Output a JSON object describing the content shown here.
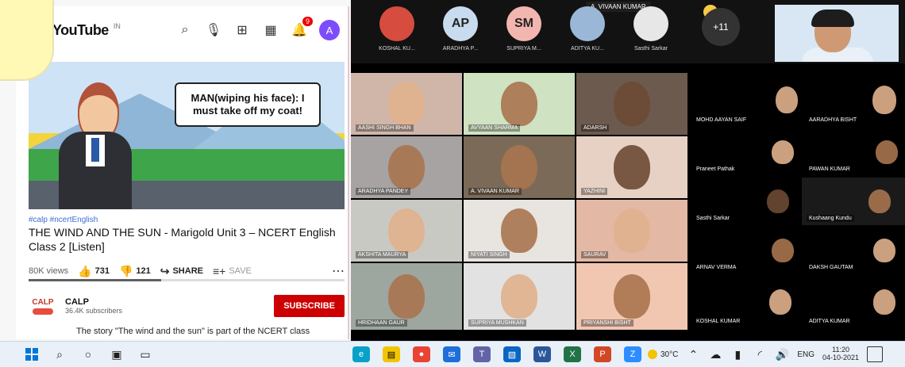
{
  "youtube": {
    "brand": "YouTube",
    "brand_sup": "IN",
    "notifications_badge": "9",
    "avatar_letter": "A",
    "video_speech": "MAN(wiping his face): I must take off my coat!",
    "hashtags": "#calp #ncertEnglish",
    "title": "THE WIND AND THE SUN - Marigold Unit 3 – NCERT English Class 2 [Listen]",
    "views": "80K views",
    "likes": "731",
    "dislikes": "121",
    "share": "SHARE",
    "save": "SAVE",
    "progress": 0.42,
    "channel_logo_text": "CALP",
    "channel_name": "CALP",
    "subscribers": "36.4K subscribers",
    "subscribe": "SUBSCRIBE",
    "description": "The story \"The wind and the sun\" is part of the NCERT class"
  },
  "meeting": {
    "presenter": "A. VIVAAN KUMAR",
    "top_participants": [
      {
        "initials": "",
        "name": "KOSHAL KU...",
        "color": "#d64c3f"
      },
      {
        "initials": "AP",
        "name": "ARADHYA P...",
        "color": "#c8dbef"
      },
      {
        "initials": "SM",
        "name": "SUPRIYA M...",
        "color": "#f2b5b0"
      },
      {
        "initials": "",
        "name": "ADITYA KU...",
        "color": "#9bb7d8"
      },
      {
        "initials": "",
        "name": "Sasthi Sarkar",
        "color": "#e7e7e7"
      }
    ],
    "more_count": "+11",
    "grid": [
      {
        "name": "AASHI SINGH BHAN"
      },
      {
        "name": "AVYAAN SHARMA"
      },
      {
        "name": "ADARSH"
      },
      {
        "name": "MOHD AAYAN SAIF"
      },
      {
        "name": "AARADHYA BISHT"
      },
      {
        "name": "ARADHYA PANDEY"
      },
      {
        "name": "A. VIVAAN KUMAR"
      },
      {
        "name": "YAZHINI"
      },
      {
        "name": "Praneet Pathak"
      },
      {
        "name": "PAWAN KUMAR"
      },
      {
        "name": "Sasthi Sarkar"
      },
      {
        "name": "Kushaang Kundu"
      },
      {
        "name": "AKSHITA MAURYA"
      },
      {
        "name": "NIYATI SINGH"
      },
      {
        "name": "SAURAV"
      },
      {
        "name": "ARNAV VERMA"
      },
      {
        "name": "DAKSH GAUTAM"
      },
      {
        "name": "HRIDHAAN GAUR"
      },
      {
        "name": "SUPRIYA MUSHKAN"
      },
      {
        "name": "PRIYANSHI BISHT"
      },
      {
        "name": "KOSHAL KUMAR"
      },
      {
        "name": "ADITYA KUMAR"
      }
    ]
  },
  "taskbar": {
    "temperature": "30°C",
    "language": "ENG",
    "time": "11:20",
    "date": "04-10-2021"
  }
}
